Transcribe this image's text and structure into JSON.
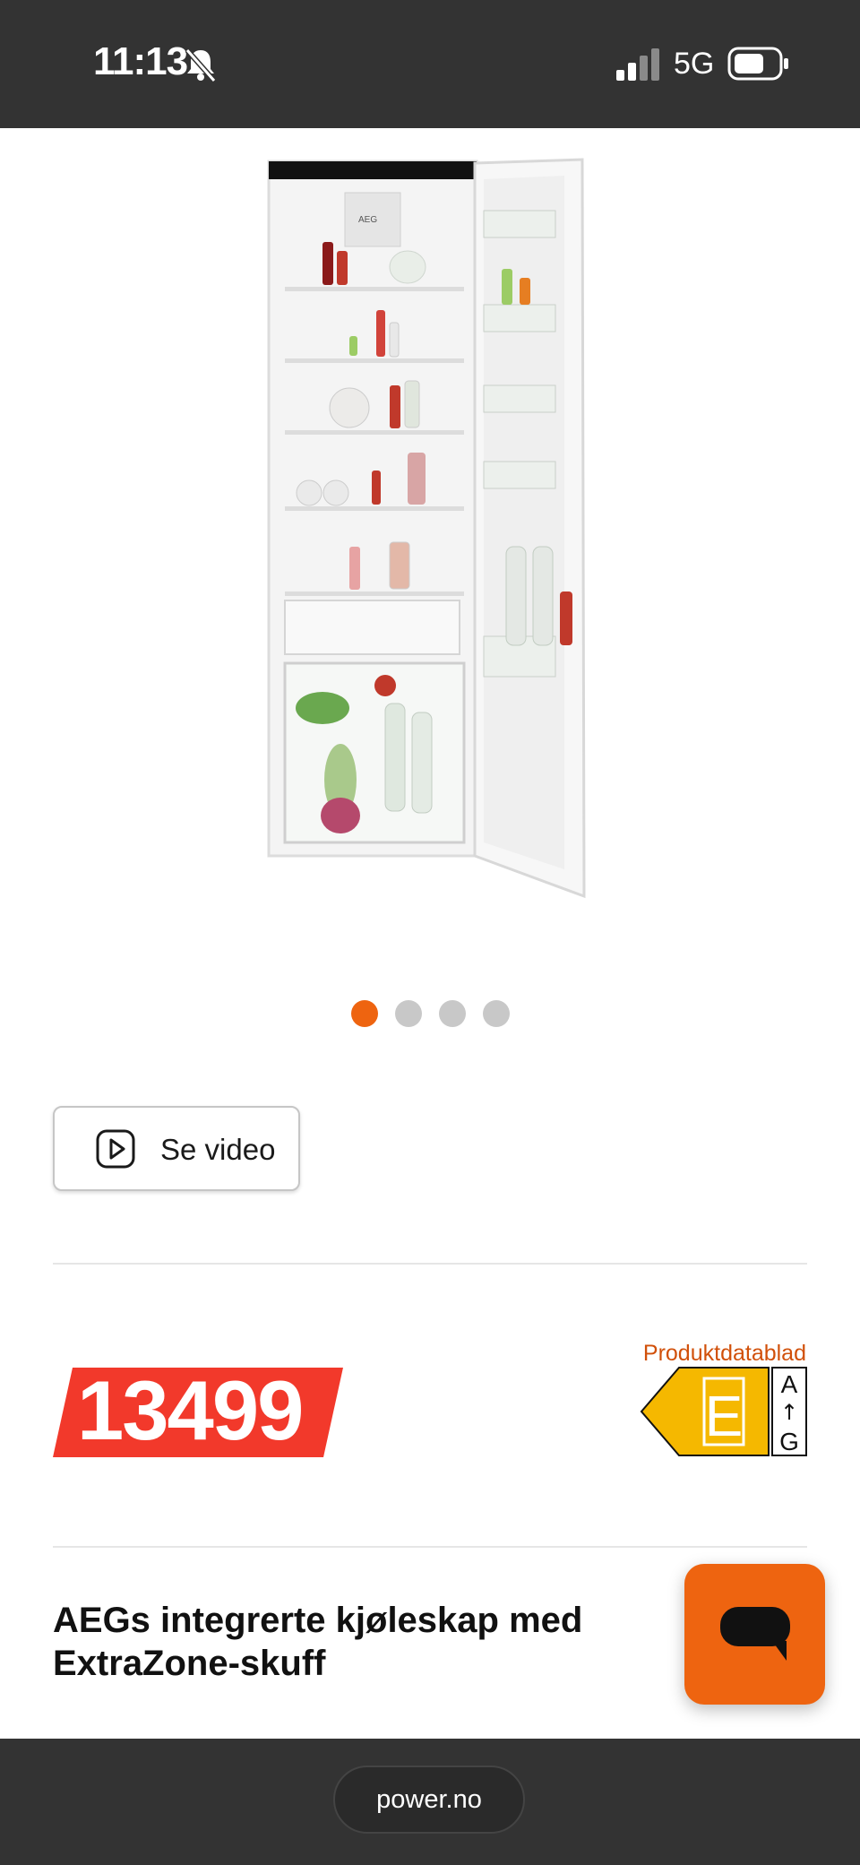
{
  "status_bar": {
    "time": "11:13",
    "network": "5G",
    "icons": [
      "bell-muted-icon",
      "signal-icon",
      "battery-icon"
    ]
  },
  "gallery": {
    "image_alt": "AEG integrated refrigerator with open door",
    "image_brand": "AEG",
    "slide_count": 4,
    "active_slide": 1
  },
  "video_button": {
    "label": "Se video",
    "icon": "play-icon"
  },
  "price": {
    "value": "13499",
    "tag_color": "#f2392b"
  },
  "energy": {
    "datasheet_link": "Produktdatablad",
    "class": "E",
    "range_top": "A",
    "range_bottom": "G",
    "arrow": "↑",
    "color": "#f5b800"
  },
  "product": {
    "title": "AEGs integrerte kjøleskap med ExtraZone-skuff"
  },
  "chat": {
    "icon": "chat-bubble-icon",
    "color": "#ee6410"
  },
  "browser": {
    "url": "power.no"
  }
}
